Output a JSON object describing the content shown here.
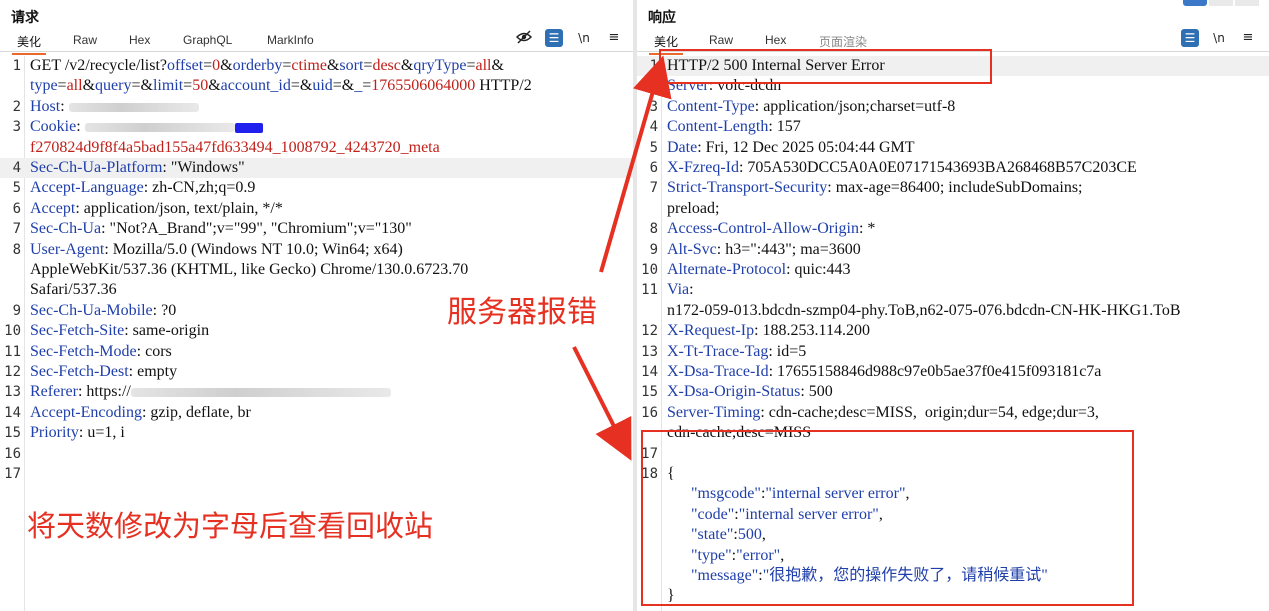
{
  "request": {
    "title": "请求",
    "tabs": [
      "美化",
      "Raw",
      "Hex",
      "GraphQL",
      "MarkInfo"
    ],
    "tools": {
      "hide_icon": "eye-off-icon",
      "wrap_icon": "list-icon",
      "newline": "\\n",
      "menu_icon": "hamburger-icon"
    },
    "lines": [
      {
        "n": "1",
        "segs": [
          [
            "t",
            "GET /v2/recycle/list?"
          ],
          [
            "p",
            "offset"
          ],
          [
            "t",
            "="
          ],
          [
            "v",
            "0"
          ],
          [
            "t",
            "&"
          ],
          [
            "p",
            "orderby"
          ],
          [
            "t",
            "="
          ],
          [
            "v",
            "ctime"
          ],
          [
            "t",
            "&"
          ],
          [
            "p",
            "sort"
          ],
          [
            "t",
            "="
          ],
          [
            "v",
            "desc"
          ],
          [
            "t",
            "&"
          ],
          [
            "p",
            "qryType"
          ],
          [
            "t",
            "="
          ],
          [
            "v",
            "all"
          ],
          [
            "t",
            "&"
          ]
        ]
      },
      {
        "n": "",
        "segs": [
          [
            "p",
            "type"
          ],
          [
            "t",
            "="
          ],
          [
            "v",
            "all"
          ],
          [
            "t",
            "&"
          ],
          [
            "p",
            "query"
          ],
          [
            "t",
            "=&"
          ],
          [
            "p",
            "limit"
          ],
          [
            "t",
            "="
          ],
          [
            "v",
            "50"
          ],
          [
            "t",
            "&"
          ],
          [
            "p",
            "account_id"
          ],
          [
            "t",
            "=&"
          ],
          [
            "p",
            "uid"
          ],
          [
            "t",
            "=&"
          ],
          [
            "p",
            "_"
          ],
          [
            "t",
            "="
          ],
          [
            "v",
            "1765506064000"
          ],
          [
            "t",
            " HTTP/2"
          ]
        ]
      },
      {
        "n": "2",
        "segs": [
          [
            "k",
            "Host"
          ],
          [
            "t",
            ": "
          ],
          [
            "blur",
            "130"
          ]
        ]
      },
      {
        "n": "3",
        "segs": [
          [
            "k",
            "Cookie"
          ],
          [
            "t",
            ": "
          ],
          [
            "blur",
            "150"
          ],
          [
            "blue",
            ""
          ]
        ]
      },
      {
        "n": "",
        "segs": [
          [
            "v",
            "f270824d9f8f4a5bad155a47fd633494_1008792_4243720_meta"
          ]
        ]
      },
      {
        "n": "4",
        "hl": true,
        "segs": [
          [
            "k",
            "Sec-Ch-Ua-Platform"
          ],
          [
            "t",
            ": \"Windows\""
          ]
        ]
      },
      {
        "n": "5",
        "segs": [
          [
            "k",
            "Accept-Language"
          ],
          [
            "t",
            ": zh-CN,zh;q=0.9"
          ]
        ]
      },
      {
        "n": "6",
        "segs": [
          [
            "k",
            "Accept"
          ],
          [
            "t",
            ": application/json, text/plain, */*"
          ]
        ]
      },
      {
        "n": "7",
        "segs": [
          [
            "k",
            "Sec-Ch-Ua"
          ],
          [
            "t",
            ": \"Not?A_Brand\";v=\"99\", \"Chromium\";v=\"130\""
          ]
        ]
      },
      {
        "n": "8",
        "segs": [
          [
            "k",
            "User-Agent"
          ],
          [
            "t",
            ": Mozilla/5.0 (Windows NT 10.0; Win64; x64)"
          ]
        ]
      },
      {
        "n": "",
        "segs": [
          [
            "t",
            "AppleWebKit/537.36 (KHTML, like Gecko) Chrome/130.0.6723.70"
          ]
        ]
      },
      {
        "n": "",
        "segs": [
          [
            "t",
            "Safari/537.36"
          ]
        ]
      },
      {
        "n": "9",
        "segs": [
          [
            "k",
            "Sec-Ch-Ua-Mobile"
          ],
          [
            "t",
            ": ?0"
          ]
        ]
      },
      {
        "n": "10",
        "segs": [
          [
            "k",
            "Sec-Fetch-Site"
          ],
          [
            "t",
            ": same-origin"
          ]
        ]
      },
      {
        "n": "11",
        "segs": [
          [
            "k",
            "Sec-Fetch-Mode"
          ],
          [
            "t",
            ": cors"
          ]
        ]
      },
      {
        "n": "12",
        "segs": [
          [
            "k",
            "Sec-Fetch-Dest"
          ],
          [
            "t",
            ": empty"
          ]
        ]
      },
      {
        "n": "13",
        "segs": [
          [
            "k",
            "Referer"
          ],
          [
            "t",
            ": https://"
          ],
          [
            "blur",
            "260"
          ]
        ]
      },
      {
        "n": "14",
        "segs": [
          [
            "k",
            "Accept-Encoding"
          ],
          [
            "t",
            ": gzip, deflate, br"
          ]
        ]
      },
      {
        "n": "15",
        "segs": [
          [
            "k",
            "Priority"
          ],
          [
            "t",
            ": u=1, i"
          ]
        ]
      },
      {
        "n": "16",
        "segs": []
      },
      {
        "n": "17",
        "segs": []
      }
    ]
  },
  "response": {
    "title": "响应",
    "tabs": [
      "美化",
      "Raw",
      "Hex",
      "页面渲染"
    ],
    "tools": {
      "wrap_icon": "list-icon",
      "newline": "\\n",
      "menu_icon": "hamburger-icon"
    },
    "lines": [
      {
        "n": "1",
        "hl": true,
        "segs": [
          [
            "t",
            "HTTP/2 500 Internal Server Error"
          ]
        ]
      },
      {
        "n": "2",
        "segs": [
          [
            "k",
            "Server"
          ],
          [
            "t",
            ": volc-dcdn"
          ]
        ]
      },
      {
        "n": "3",
        "segs": [
          [
            "k",
            "Content-Type"
          ],
          [
            "t",
            ": application/json;charset=utf-8"
          ]
        ]
      },
      {
        "n": "4",
        "segs": [
          [
            "k",
            "Content-Length"
          ],
          [
            "t",
            ": 157"
          ]
        ]
      },
      {
        "n": "5",
        "segs": [
          [
            "k",
            "Date"
          ],
          [
            "t",
            ": Fri, 12 Dec 2025 05:04:44 GMT"
          ]
        ]
      },
      {
        "n": "6",
        "segs": [
          [
            "k",
            "X-Fzreq-Id"
          ],
          [
            "t",
            ": 705A530DCC5A0A0E07171543693BA268468B57C203CE"
          ]
        ]
      },
      {
        "n": "7",
        "segs": [
          [
            "k",
            "Strict-Transport-Security"
          ],
          [
            "t",
            ": max-age=86400; includeSubDomains;"
          ]
        ]
      },
      {
        "n": "",
        "segs": [
          [
            "t",
            "preload;"
          ]
        ]
      },
      {
        "n": "8",
        "segs": [
          [
            "k",
            "Access-Control-Allow-Origin"
          ],
          [
            "t",
            ": *"
          ]
        ]
      },
      {
        "n": "9",
        "segs": [
          [
            "k",
            "Alt-Svc"
          ],
          [
            "t",
            ": h3=\":443\"; ma=3600"
          ]
        ]
      },
      {
        "n": "10",
        "segs": [
          [
            "k",
            "Alternate-Protocol"
          ],
          [
            "t",
            ": quic:443"
          ]
        ]
      },
      {
        "n": "11",
        "segs": [
          [
            "k",
            "Via"
          ],
          [
            "t",
            ":"
          ]
        ]
      },
      {
        "n": "",
        "segs": [
          [
            "t",
            "n172-059-013.bdcdn-szmp04-phy.ToB,n62-075-076.bdcdn-CN-HK-HKG1.ToB"
          ]
        ]
      },
      {
        "n": "12",
        "segs": [
          [
            "k",
            "X-Request-Ip"
          ],
          [
            "t",
            ": 188.253.114.200"
          ]
        ]
      },
      {
        "n": "13",
        "segs": [
          [
            "k",
            "X-Tt-Trace-Tag"
          ],
          [
            "t",
            ": id=5"
          ]
        ]
      },
      {
        "n": "14",
        "segs": [
          [
            "k",
            "X-Dsa-Trace-Id"
          ],
          [
            "t",
            ": 17655158846d988c97e0b5ae37f0e415f093181c7a"
          ]
        ]
      },
      {
        "n": "15",
        "segs": [
          [
            "k",
            "X-Dsa-Origin-Status"
          ],
          [
            "t",
            ": 500"
          ]
        ]
      },
      {
        "n": "16",
        "segs": [
          [
            "k",
            "Server-Timing"
          ],
          [
            "t",
            ": cdn-cache;desc=MISS,  origin;dur=54, edge;dur=3,"
          ]
        ]
      },
      {
        "n": "",
        "segs": [
          [
            "t",
            "cdn-cache;desc=MISS"
          ]
        ]
      },
      {
        "n": "17",
        "segs": []
      },
      {
        "n": "18",
        "segs": [
          [
            "t",
            "{"
          ]
        ]
      },
      {
        "n": "",
        "segs": [
          [
            "t",
            "      "
          ],
          [
            "k",
            "\"msgcode\""
          ],
          [
            "t",
            ":"
          ],
          [
            "k",
            "\"internal server error\""
          ],
          [
            "t",
            ","
          ]
        ]
      },
      {
        "n": "",
        "segs": [
          [
            "t",
            "      "
          ],
          [
            "k",
            "\"code\""
          ],
          [
            "t",
            ":"
          ],
          [
            "k",
            "\"internal server error\""
          ],
          [
            "t",
            ","
          ]
        ]
      },
      {
        "n": "",
        "segs": [
          [
            "t",
            "      "
          ],
          [
            "k",
            "\"state\""
          ],
          [
            "t",
            ":"
          ],
          [
            "k",
            "500"
          ],
          [
            "t",
            ","
          ]
        ]
      },
      {
        "n": "",
        "segs": [
          [
            "t",
            "      "
          ],
          [
            "k",
            "\"type\""
          ],
          [
            "t",
            ":"
          ],
          [
            "k",
            "\"error\""
          ],
          [
            "t",
            ","
          ]
        ]
      },
      {
        "n": "",
        "segs": [
          [
            "t",
            "      "
          ],
          [
            "k",
            "\"message\""
          ],
          [
            "t",
            ":"
          ],
          [
            "k",
            "\"很抱歉，您的操作失败了，请稍候重试\""
          ]
        ]
      },
      {
        "n": "",
        "segs": [
          [
            "t",
            "}"
          ]
        ]
      }
    ]
  },
  "annotations": {
    "server_error": "服务器报错",
    "instruction": "将天数修改为字母后查看回收站"
  },
  "colors": {
    "accent": "#e53022",
    "key": "#1f3faa",
    "value": "#c0201a",
    "tab_underline": "#e8692b"
  }
}
